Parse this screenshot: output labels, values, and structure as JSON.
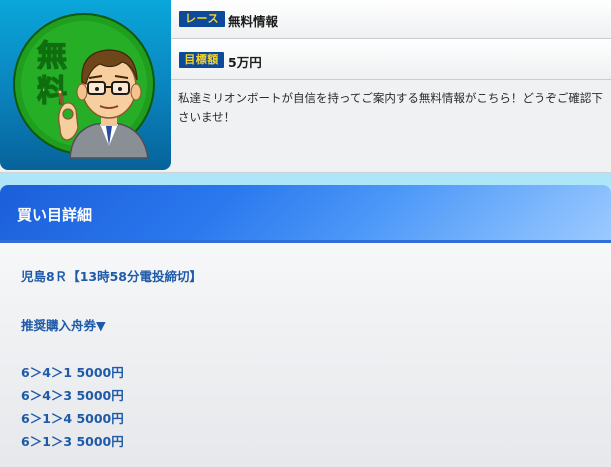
{
  "info_card": {
    "race_tag": "レース",
    "race_value": "無料情報",
    "target_tag": "目標額",
    "target_value": "5万円",
    "description": "私達ミリオンボートが自信を持ってご案内する無料情報がこちら！どうぞご確認下さいませ！",
    "thumbnail": {
      "badge_text_1": "無",
      "badge_text_2": "料",
      "icon": "businessman-ok-gesture-icon"
    }
  },
  "detail": {
    "title": "買い目詳細",
    "race_info": "児島8Ｒ【13時58分電投締切】",
    "recommend_label": "推奨購入舟券▼",
    "bets": [
      "6＞4＞1 5000円",
      "6＞4＞3 5000円",
      "6＞1＞4 5000円",
      "6＞1＞3 5000円"
    ]
  },
  "colors": {
    "page_bg": "#ade6f9",
    "tag_bg": "#0d4a9a",
    "tag_text": "#f7d428",
    "header_blue": "#2a77ee",
    "body_text_blue": "#1f5aa8",
    "badge_green": "#1fa51f"
  }
}
